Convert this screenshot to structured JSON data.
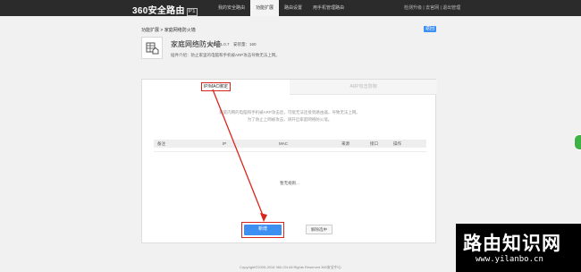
{
  "topbar": {
    "brand": "360安全路由",
    "brand_badge": "P1",
    "nav": [
      "我的安全路由",
      "功能扩展",
      "路由设置",
      "用手机管理路由"
    ],
    "active_nav": "功能扩展",
    "right_links": "检测升级 | 去官网 | 退出管理"
  },
  "breadcrumb": "功能扩展 > 家庭网络防火墙",
  "back_label": "返回",
  "app": {
    "icon": "firewall-app-icon",
    "name": "家庭网络防火墙",
    "version": "版本：1.0.7　安装量：160",
    "description": "插件介绍：防止家里的电脑和手机被ARP攻击导致无法上网。"
  },
  "tabs": {
    "ipmac": "IP/MAC绑定",
    "arp": "ARP攻击防御"
  },
  "desc_lines": [
    "家庭内网的电脑和手机被ARP攻击后，可能无法连接到路由器，导致无法上网。",
    "为了防止上网被攻击，请开启家庭网络防火墙。"
  ],
  "table": {
    "columns": [
      "备注",
      "IP",
      "MAC",
      "来源",
      "接口",
      "操作"
    ],
    "empty_text": "暂无规则..."
  },
  "buttons": {
    "add": "新增",
    "unbind": "解除选中"
  },
  "footer": "Copyright©2005-2016 360.CN All Rights Reserved 360安全中心",
  "watermark": {
    "title": "路由知识网",
    "url": "www.yilanbo.cn"
  },
  "colors": {
    "topbar": "#2b2b2b",
    "accent": "#3d8ff2",
    "highlight": "#d9261c",
    "side_handle": "#3fb246"
  }
}
